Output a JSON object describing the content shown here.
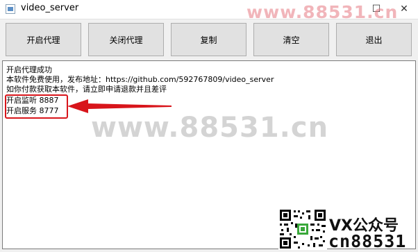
{
  "window": {
    "title": "video_server",
    "maximize_glyph": "☐",
    "close_glyph": "✕",
    "icon": "app-window-icon"
  },
  "toolbar": {
    "buttons": [
      {
        "label": "开启代理"
      },
      {
        "label": "关闭代理"
      },
      {
        "label": "复制"
      },
      {
        "label": "清空"
      },
      {
        "label": "退出"
      }
    ]
  },
  "output": {
    "lines": [
      "开启代理成功",
      "本软件免费使用，发布地址：https://github.com/592767809/video_server",
      "如你付款获取本软件，请立即申请退款并且差评",
      "开启监听 8887",
      "开启服务 8777"
    ]
  },
  "annotation": {
    "highlight_color": "#d8151b",
    "arrow_icon": "left-arrow-icon"
  },
  "watermarks": {
    "top": "www.88531.cn",
    "center": "www.88531.cn",
    "vx": "VX公众号",
    "cn": "cn88531"
  }
}
